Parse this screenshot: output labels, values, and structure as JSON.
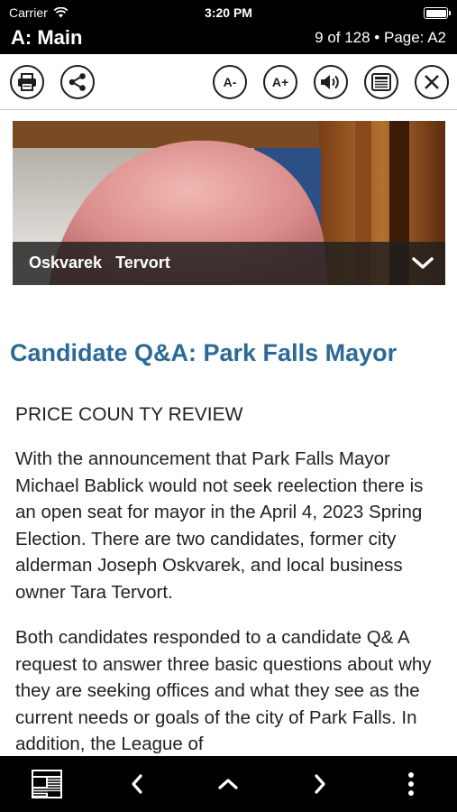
{
  "status_bar": {
    "carrier": "Carrier",
    "time": "3:20 PM"
  },
  "title_bar": {
    "section": "A: Main",
    "page_info": "9 of 128 • Page: A2"
  },
  "toolbar": {
    "print_icon": "printer-icon",
    "share_icon": "share-icon",
    "font_decrease_label": "A-",
    "font_increase_label": "A+",
    "audio_icon": "speaker-icon",
    "text_view_icon": "article-text-icon",
    "close_icon": "close-icon"
  },
  "photo": {
    "caption": "Oskvarek   Tervort"
  },
  "article": {
    "headline": "Candidate Q&A: Park Falls Mayor",
    "byline": "PRICE COUN TY REVIEW",
    "paragraphs": [
      "With the announcement that Park Falls Mayor Michael Bablick would not seek reelection there is an open seat for mayor in the April 4, 2023 Spring Election. There are two candidates, former city alderman Joseph Oskvarek, and local business owner Tara Tervort.",
      "Both candidates responded to a candidate Q& A request to answer three basic questions about why they are seeking offices and what they see as the current needs or goals of the city of Park Falls. In addition, the League of"
    ]
  },
  "colors": {
    "headline": "#2b6a96",
    "bars": "#000000"
  }
}
